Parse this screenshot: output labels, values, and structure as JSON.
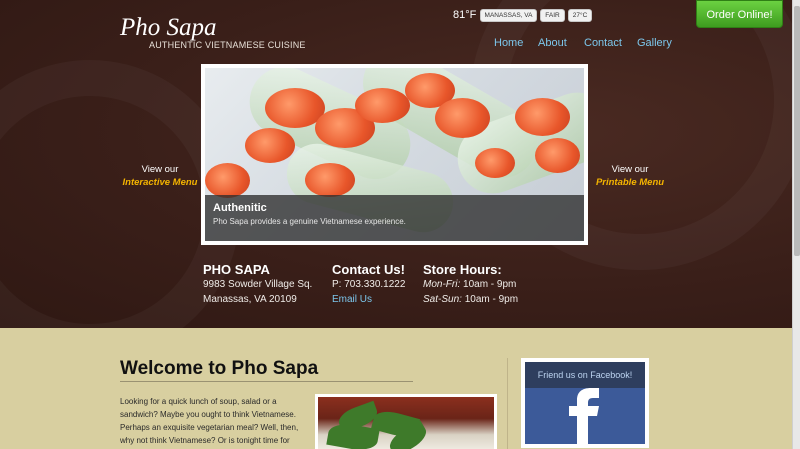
{
  "brand": {
    "name": "Pho Sapa",
    "tagline": "AUTHENTIC VIETNAMESE CUISINE"
  },
  "weather": {
    "temperature": "81°F",
    "location": "MANASSAS, VA",
    "condition": "FAIR",
    "celsius": "27°C"
  },
  "order_button": "Order Online!",
  "nav": [
    "Home",
    "About",
    "Contact",
    "Gallery"
  ],
  "slideshow": {
    "title": "Authenitic",
    "description": "Pho Sapa provides a genuine Vietnamese experience."
  },
  "menu_links": {
    "left": {
      "prefix": "View our",
      "label": "Interactive Menu"
    },
    "right": {
      "prefix": "View our",
      "label": "Printable Menu"
    }
  },
  "address": {
    "heading": "PHO SAPA",
    "street": "9983 Sowder Village Sq.",
    "city": "Manassas, VA 20109"
  },
  "contact": {
    "heading": "Contact Us!",
    "phone": "P: 703.330.1222",
    "email": "Email Us"
  },
  "hours": {
    "heading": "Store Hours:",
    "rows": [
      {
        "days": "Mon-Fri:",
        "time": "10am - 9pm"
      },
      {
        "days": "Sat-Sun:",
        "time": "10am - 9pm"
      }
    ]
  },
  "welcome": {
    "title": "Welcome to Pho Sapa",
    "lines": [
      "Looking for a quick lunch of soup, salad or a",
      "sandwich? Maybe you ought to think Vietnamese.",
      "Perhaps an exquisite vegetarian meal? Well, then,",
      "why not think Vietnamese? Or is tonight time for"
    ]
  },
  "facebook": {
    "label": "Friend us on Facebook!"
  },
  "colors": {
    "header_bg": "#3a1f19",
    "body_bg": "#d8cfa0",
    "nav": "#7cc7ec",
    "accent": "#f4b400",
    "order_green": "#4fb52a",
    "facebook": "#3c5a99"
  }
}
